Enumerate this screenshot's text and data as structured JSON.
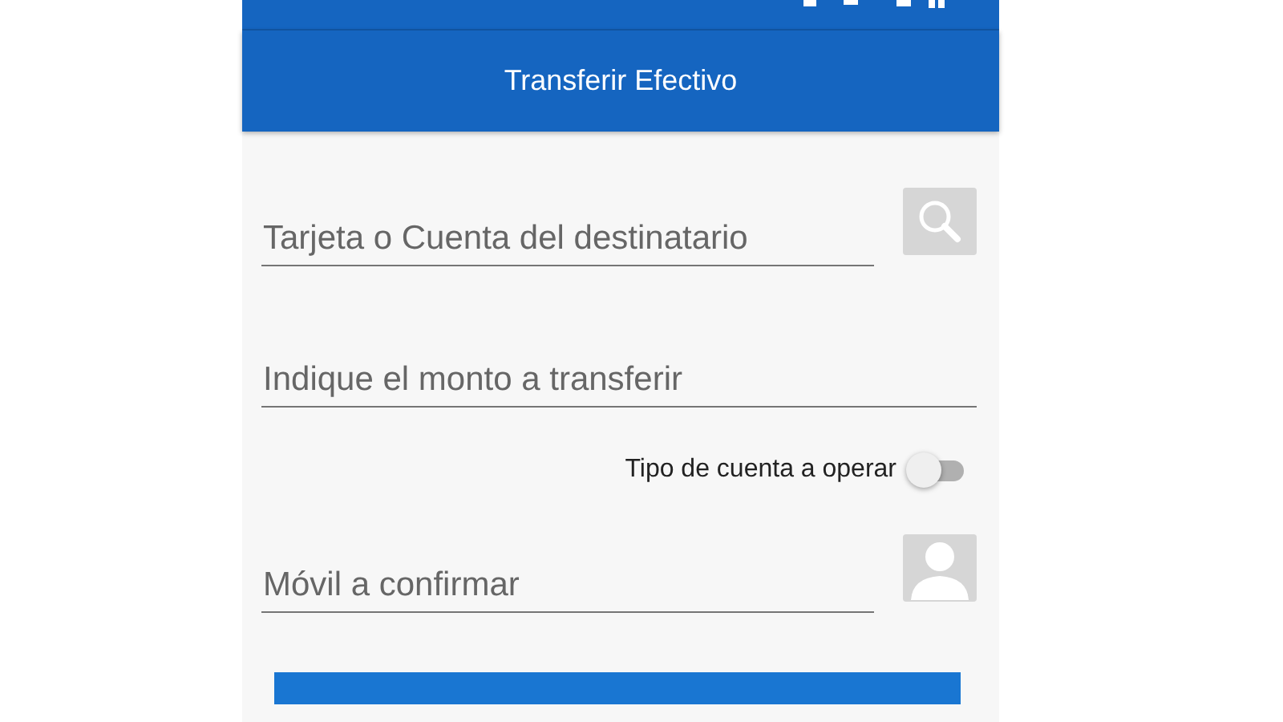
{
  "app_bar": {
    "title": "Transferir Efectivo"
  },
  "fields": [
    {
      "placeholder": "Tarjeta o Cuenta del destinatario",
      "kind": "search"
    },
    {
      "placeholder": "Indique el monto a transferir",
      "kind": "plain"
    }
  ],
  "account_type_switch": {
    "label": "Tipo de cuenta a operar",
    "on": false
  },
  "phone_field": {
    "placeholder": "Móvil a confirmar",
    "kind": "contact"
  }
}
